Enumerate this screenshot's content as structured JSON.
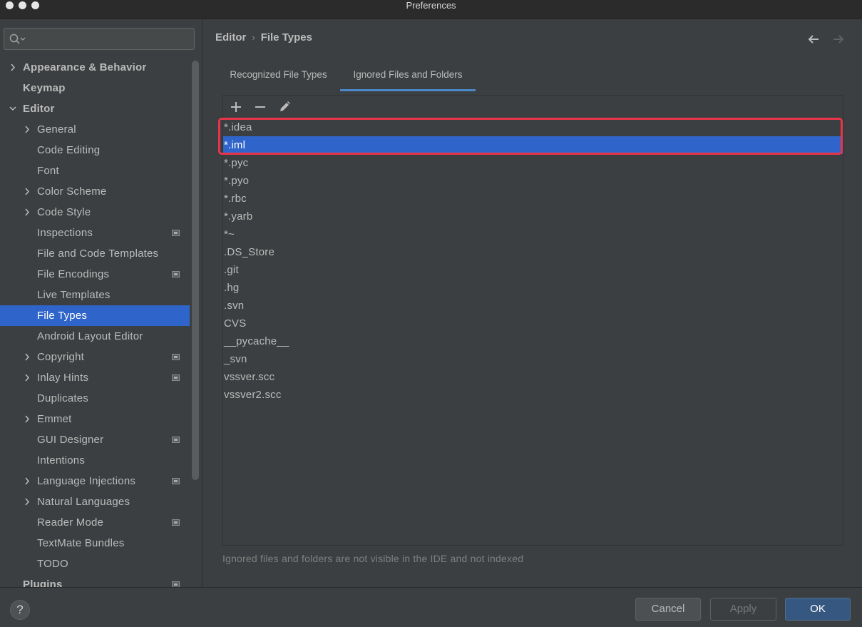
{
  "window": {
    "title": "Preferences"
  },
  "search": {
    "placeholder": ""
  },
  "sidebar": {
    "items": [
      {
        "label": "Appearance & Behavior",
        "chevron": "right",
        "bold": true,
        "level": 0
      },
      {
        "label": "Keymap",
        "chevron": "none",
        "bold": true,
        "level": 0
      },
      {
        "label": "Editor",
        "chevron": "down",
        "bold": true,
        "level": 0
      },
      {
        "label": "General",
        "chevron": "right",
        "level": 1
      },
      {
        "label": "Code Editing",
        "chevron": "none",
        "level": 1
      },
      {
        "label": "Font",
        "chevron": "none",
        "level": 1
      },
      {
        "label": "Color Scheme",
        "chevron": "right",
        "level": 1
      },
      {
        "label": "Code Style",
        "chevron": "right",
        "level": 1
      },
      {
        "label": "Inspections",
        "chevron": "none",
        "level": 1,
        "project_icon": true
      },
      {
        "label": "File and Code Templates",
        "chevron": "none",
        "level": 1
      },
      {
        "label": "File Encodings",
        "chevron": "none",
        "level": 1,
        "project_icon": true
      },
      {
        "label": "Live Templates",
        "chevron": "none",
        "level": 1
      },
      {
        "label": "File Types",
        "chevron": "none",
        "level": 1,
        "selected": true
      },
      {
        "label": "Android Layout Editor",
        "chevron": "none",
        "level": 1
      },
      {
        "label": "Copyright",
        "chevron": "right",
        "level": 1,
        "project_icon": true
      },
      {
        "label": "Inlay Hints",
        "chevron": "right",
        "level": 1,
        "project_icon": true
      },
      {
        "label": "Duplicates",
        "chevron": "none",
        "level": 1
      },
      {
        "label": "Emmet",
        "chevron": "right",
        "level": 1
      },
      {
        "label": "GUI Designer",
        "chevron": "none",
        "level": 1,
        "project_icon": true
      },
      {
        "label": "Intentions",
        "chevron": "none",
        "level": 1
      },
      {
        "label": "Language Injections",
        "chevron": "right",
        "level": 1,
        "project_icon": true
      },
      {
        "label": "Natural Languages",
        "chevron": "right",
        "level": 1
      },
      {
        "label": "Reader Mode",
        "chevron": "none",
        "level": 1,
        "project_icon": true
      },
      {
        "label": "TextMate Bundles",
        "chevron": "none",
        "level": 1
      },
      {
        "label": "TODO",
        "chevron": "none",
        "level": 1
      },
      {
        "label": "Plugins",
        "chevron": "none",
        "bold": true,
        "level": 0,
        "project_icon": true
      }
    ]
  },
  "breadcrumb": {
    "parent": "Editor",
    "current": "File Types",
    "separator": "›"
  },
  "tabs": [
    {
      "label": "Recognized File Types",
      "active": false
    },
    {
      "label": "Ignored Files and Folders",
      "active": true
    }
  ],
  "toolbar": {
    "add_icon": "plus-icon",
    "remove_icon": "minus-icon",
    "edit_icon": "pencil-icon"
  },
  "ignored_list": [
    {
      "value": "*.idea"
    },
    {
      "value": "*.iml",
      "selected": true
    },
    {
      "value": "*.pyc"
    },
    {
      "value": "*.pyo"
    },
    {
      "value": "*.rbc"
    },
    {
      "value": "*.yarb"
    },
    {
      "value": "*~"
    },
    {
      "value": ".DS_Store"
    },
    {
      "value": ".git"
    },
    {
      "value": ".hg"
    },
    {
      "value": ".svn"
    },
    {
      "value": "CVS"
    },
    {
      "value": "__pycache__"
    },
    {
      "value": "_svn"
    },
    {
      "value": "vssver.scc"
    },
    {
      "value": "vssver2.scc"
    }
  ],
  "hint": "Ignored files and folders are not visible in the IDE and not indexed",
  "buttons": {
    "help": "?",
    "cancel": "Cancel",
    "apply": "Apply",
    "ok": "OK"
  },
  "colors": {
    "accent": "#2f65ca",
    "highlight_box": "#e9344a",
    "tab_underline": "#4a88c7",
    "ok_button": "#365880"
  }
}
